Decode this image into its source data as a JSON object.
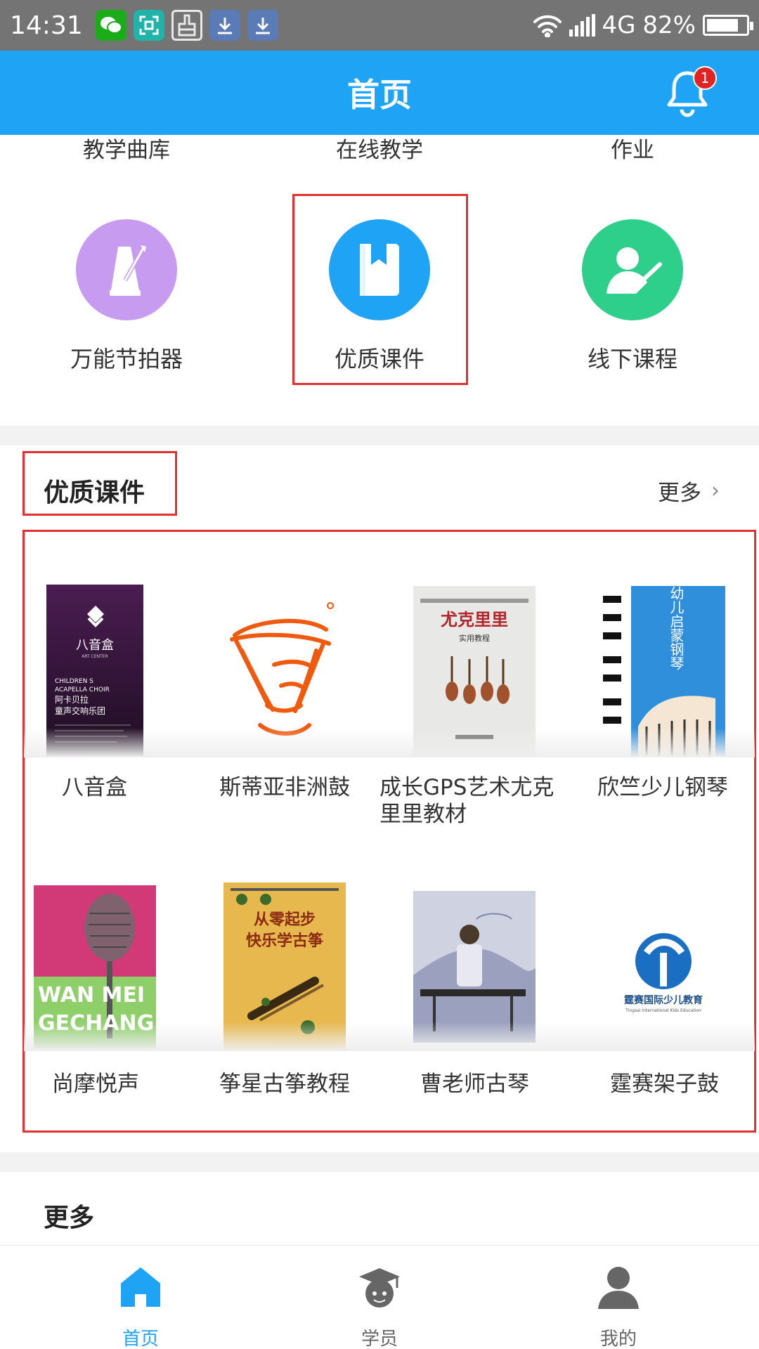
{
  "status_bar": {
    "time": "14:31",
    "network": "4G",
    "battery": "82%",
    "battery_level": 0.82
  },
  "header": {
    "title": "首页",
    "notification_count": "1"
  },
  "top_categories": [
    "教学曲库",
    "在线教学",
    "作业"
  ],
  "tools": [
    {
      "label": "万能节拍器",
      "icon": "metronome-icon",
      "color": "#c79bf0"
    },
    {
      "label": "优质课件",
      "icon": "bookmark-book-icon",
      "color": "#1fa3f5"
    },
    {
      "label": "线下课程",
      "icon": "teacher-icon",
      "color": "#2ecf8a"
    }
  ],
  "courseware": {
    "title": "优质课件",
    "more_label": "更多",
    "items": [
      {
        "name": "八音盒",
        "cover_text": [
          "八音盒",
          "ART CENTER",
          "CHILDREN S",
          "ACAPELLA CHOIR",
          "阿卡贝拉",
          "童声交响乐团"
        ]
      },
      {
        "name": "斯蒂亚非洲鼓",
        "cover_text": []
      },
      {
        "name": "成长GPS艺术尤克里里教材",
        "cover_text": [
          "尤克里里",
          "实用教程"
        ]
      },
      {
        "name": "欣竺少儿钢琴",
        "cover_text": [
          "幼儿启蒙钢琴"
        ]
      },
      {
        "name": "尚摩悦声",
        "cover_text": [
          "WAN MEI",
          "GECHANG"
        ]
      },
      {
        "name": "筝星古筝教程",
        "cover_text": [
          "从零起步",
          "快乐学古筝"
        ]
      },
      {
        "name": "曹老师古琴",
        "cover_text": []
      },
      {
        "name": "霆赛架子鼓",
        "cover_text": [
          "霆赛国际少儿教育",
          "Tingsai International Kids Education"
        ]
      }
    ]
  },
  "more_section": {
    "title": "更多"
  },
  "tabs": [
    {
      "label": "首页",
      "icon": "home-icon",
      "active": true
    },
    {
      "label": "学员",
      "icon": "student-icon",
      "active": false
    },
    {
      "label": "我的",
      "icon": "profile-icon",
      "active": false
    }
  ],
  "colors": {
    "primary": "#1fa3f5",
    "highlight": "#e03232",
    "badge": "#e02424"
  }
}
